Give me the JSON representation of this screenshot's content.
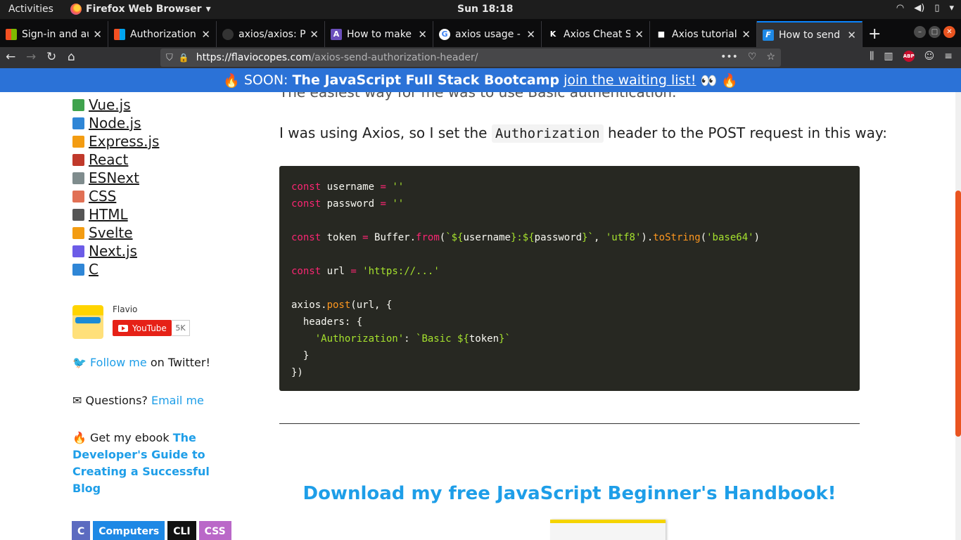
{
  "system": {
    "activities": "Activities",
    "app_name": "Firefox Web Browser",
    "app_menu_arrow": "▾",
    "clock": "Sun 18:18",
    "tray": [
      "wifi-icon",
      "volume-icon",
      "battery-icon",
      "power-menu-icon"
    ]
  },
  "tabs": [
    {
      "title": "Sign-in and au",
      "favicon": "microsoft-icon",
      "active": false
    },
    {
      "title": "Authorization",
      "favicon": "microsoft-icon",
      "active": false
    },
    {
      "title": "axios/axios: Pr",
      "favicon": "github-icon",
      "active": false
    },
    {
      "title": "How to make",
      "favicon": "a-icon",
      "active": false
    },
    {
      "title": "axios usage -",
      "favicon": "google-icon",
      "active": false
    },
    {
      "title": "Axios Cheat S",
      "favicon": "k-icon",
      "active": false
    },
    {
      "title": "Axios tutorial",
      "favicon": "square-icon",
      "active": false
    },
    {
      "title": "How to send t",
      "favicon": "f-icon",
      "active": true
    }
  ],
  "tab_close": "✕",
  "new_tab": "+",
  "navbar": {
    "url_domain": "https://flaviocopes.com",
    "url_path": "/axios-send-authorization-header/",
    "more": "•••",
    "abp": "ABP"
  },
  "banner": {
    "emoji_left": "🔥",
    "prefix": "SOON:",
    "title": "The JavaScript Full Stack Bootcamp",
    "link": "join the waiting list!",
    "emoji_eyes": "👀",
    "emoji_right": "🔥"
  },
  "sidebar": {
    "topics": [
      {
        "label": "Vue.js",
        "color": "#3fa34d"
      },
      {
        "label": "Node.js",
        "color": "#2f86d6"
      },
      {
        "label": "Express.js",
        "color": "#f39c12"
      },
      {
        "label": "React",
        "color": "#c0392b"
      },
      {
        "label": "ESNext",
        "color": "#7f8c8d"
      },
      {
        "label": "CSS",
        "color": "#e17055"
      },
      {
        "label": "HTML",
        "color": "#555555"
      },
      {
        "label": "Svelte",
        "color": "#f39c12"
      },
      {
        "label": "Next.js",
        "color": "#6c5ce7"
      },
      {
        "label": "C",
        "color": "#2f86d6"
      }
    ],
    "author_name": "Flavio",
    "youtube_label": "YouTube",
    "youtube_count": "5K",
    "twitter_emoji": "🐦",
    "twitter_link": "Follow me",
    "twitter_suffix": "on Twitter!",
    "questions_emoji": "✉",
    "questions_text": "Questions?",
    "questions_link": "Email me",
    "ebook_emoji": "🔥",
    "ebook_text": "Get my ebook",
    "ebook_link": "The Developer's Guide to Creating a Successful Blog",
    "tags": [
      {
        "label": "C",
        "color": "#5c6bc0"
      },
      {
        "label": "Computers",
        "color": "#1e88e5"
      },
      {
        "label": "CLI",
        "color": "#111111"
      },
      {
        "label": "CSS",
        "color": "#ba68c8"
      }
    ]
  },
  "article": {
    "partial_line": "The easiest way for me was to use Basic authentication.",
    "intro_before": "I was using Axios, so I set the",
    "intro_code": "Authorization",
    "intro_after": "header to the POST request in this way:",
    "cta": "Download my free JavaScript Beginner's Handbook!"
  }
}
